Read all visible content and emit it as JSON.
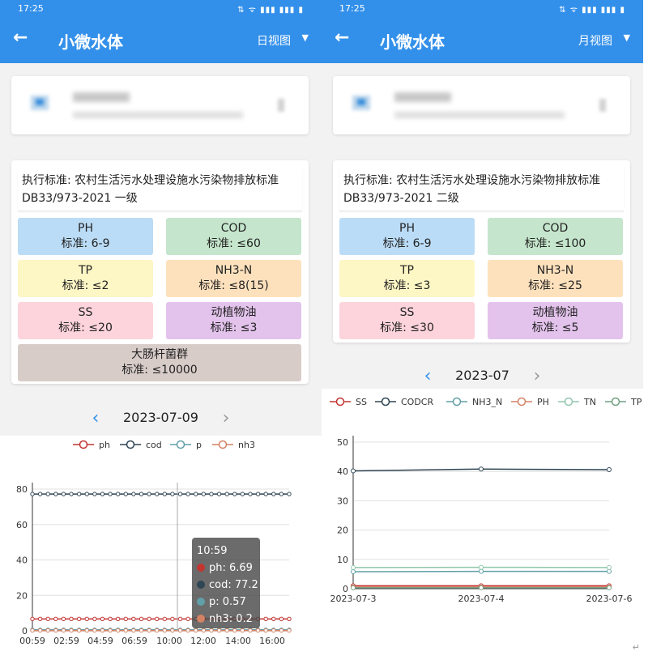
{
  "left": {
    "status": {
      "time": "17:25",
      "icons": "⇅ ᯤ ▮▮▮ ▮▮▮ ▮"
    },
    "app": {
      "back_icon": "arrow-left-icon",
      "title": "小微水体",
      "view_label": "日视图",
      "view_caret": "▼"
    },
    "standard": {
      "line1": "执行标准: 农村生活污水处理设施水污染物排放标准",
      "line2": "DB33/973-2021 一级",
      "params": [
        {
          "name": "PH",
          "std": "标准: 6-9",
          "color": "#bbdcf7"
        },
        {
          "name": "COD",
          "std": "标准: ≤60",
          "color": "#c5e6cc"
        },
        {
          "name": "TP",
          "std": "标准: ≤2",
          "color": "#fdf6c5"
        },
        {
          "name": "NH3-N",
          "std": "标准: ≤8(15)",
          "color": "#fde1bd"
        },
        {
          "name": "SS",
          "std": "标准: ≤20",
          "color": "#fdd4dc"
        },
        {
          "name": "动植物油",
          "std": "标准: ≤3",
          "color": "#e3c3ec"
        },
        {
          "name": "大肠杆菌群",
          "std": "标准: ≤10000",
          "color": "#d8ccc9"
        }
      ]
    },
    "date_nav": {
      "prev": "‹",
      "date": "2023-07-09",
      "next": "›"
    },
    "tooltip": {
      "time": "10:59",
      "rows": [
        {
          "label": "ph: 6.69",
          "color": "#c23531"
        },
        {
          "label": "cod: 77.2",
          "color": "#2f4554"
        },
        {
          "label": "p: 0.57",
          "color": "#61a0a8"
        },
        {
          "label": "nh3: 0.2",
          "color": "#d48265"
        }
      ]
    }
  },
  "right": {
    "status": {
      "time": "17:25",
      "icons": "⇅ ᯤ ▮▮▮ ▮▮▮ ▮"
    },
    "app": {
      "back_icon": "arrow-left-icon",
      "title": "小微水体",
      "view_label": "月视图",
      "view_caret": "▼"
    },
    "standard": {
      "line1": "执行标准: 农村生活污水处理设施水污染物排放标准",
      "line2": "DB33/973-2021 二级",
      "params": [
        {
          "name": "PH",
          "std": "标准: 6-9",
          "color": "#bbdcf7"
        },
        {
          "name": "COD",
          "std": "标准: ≤100",
          "color": "#c5e6cc"
        },
        {
          "name": "TP",
          "std": "标准: ≤3",
          "color": "#fdf6c5"
        },
        {
          "name": "NH3-N",
          "std": "标准: ≤25",
          "color": "#fde1bd"
        },
        {
          "name": "SS",
          "std": "标准: ≤30",
          "color": "#fdd4dc"
        },
        {
          "name": "动植物油",
          "std": "标准: ≤5",
          "color": "#e3c3ec"
        }
      ]
    },
    "date_nav": {
      "prev": "‹",
      "date": "2023-07",
      "next": "›"
    },
    "corner_mark": "↵"
  },
  "chart_data": [
    {
      "type": "line",
      "x": [
        "00:59",
        "02:59",
        "04:59",
        "06:59",
        "10:00",
        "12:00",
        "14:00",
        "16:00"
      ],
      "ylim": [
        0,
        80
      ],
      "yticks": [
        0,
        20,
        40,
        60,
        80
      ],
      "grid": true,
      "legend": "top",
      "series": [
        {
          "name": "ph",
          "color": "#c23531",
          "values": [
            6.7,
            6.7,
            6.7,
            6.7,
            6.69,
            6.7,
            6.7,
            6.7
          ]
        },
        {
          "name": "cod",
          "color": "#2f4554",
          "values": [
            77.2,
            77.2,
            77.2,
            77.2,
            77.2,
            77.2,
            77.2,
            77.2
          ]
        },
        {
          "name": "p",
          "color": "#61a0a8",
          "values": [
            0.57,
            0.57,
            0.57,
            0.57,
            0.57,
            0.57,
            0.57,
            0.57
          ]
        },
        {
          "name": "nh3",
          "color": "#d48265",
          "values": [
            0.2,
            0.2,
            0.2,
            0.2,
            0.2,
            0.2,
            0.2,
            0.2
          ]
        }
      ]
    },
    {
      "type": "line",
      "x": [
        "2023-07-3",
        "2023-07-4",
        "2023-07-6"
      ],
      "ylim": [
        0,
        50
      ],
      "yticks": [
        0,
        10,
        20,
        30,
        40,
        50
      ],
      "grid": true,
      "legend": "top",
      "series": [
        {
          "name": "SS",
          "color": "#c23531",
          "values": [
            1,
            1,
            1
          ]
        },
        {
          "name": "CODCR",
          "color": "#2f4554",
          "values": [
            40.2,
            40.8,
            40.6
          ]
        },
        {
          "name": "NH3_N",
          "color": "#61a0a8",
          "values": [
            5.8,
            5.9,
            5.9
          ]
        },
        {
          "name": "PH",
          "color": "#d48265",
          "values": [
            0.6,
            0.6,
            0.6
          ]
        },
        {
          "name": "TN",
          "color": "#91c7ae",
          "values": [
            7.2,
            7.3,
            7.2
          ]
        },
        {
          "name": "TP",
          "color": "#749f83",
          "values": [
            0.3,
            0.3,
            0.3
          ]
        }
      ]
    }
  ]
}
